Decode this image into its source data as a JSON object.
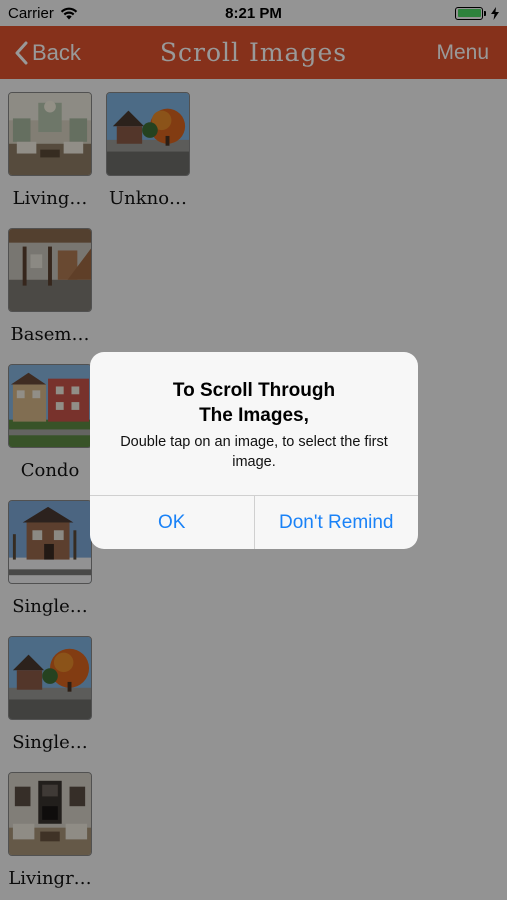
{
  "status_bar": {
    "carrier": "Carrier",
    "time": "8:21 PM"
  },
  "nav": {
    "back_label": "Back",
    "title": "Scroll Images",
    "menu_label": "Menu",
    "bar_color": "#e0532e"
  },
  "items": [
    {
      "caption": "Living…",
      "icon": "living-room-photo"
    },
    {
      "caption": "Unkno…",
      "icon": "house-autumn-photo"
    },
    {
      "caption": "Basem…",
      "icon": "basement-photo"
    },
    {
      "caption": "Condo",
      "icon": "condo-photo"
    },
    {
      "caption": "Single…",
      "icon": "house-winter-photo"
    },
    {
      "caption": "Single…",
      "icon": "house-autumn-photo"
    },
    {
      "caption": "Livingr…",
      "icon": "livingroom-fireplace-photo"
    }
  ],
  "alert": {
    "title_line1": "To Scroll Through",
    "title_line2": "The Images,",
    "message": "Double tap on an image, to select the first image.",
    "ok_label": "OK",
    "dont_remind_label": "Don't Remind",
    "button_color": "#1a82f7"
  }
}
